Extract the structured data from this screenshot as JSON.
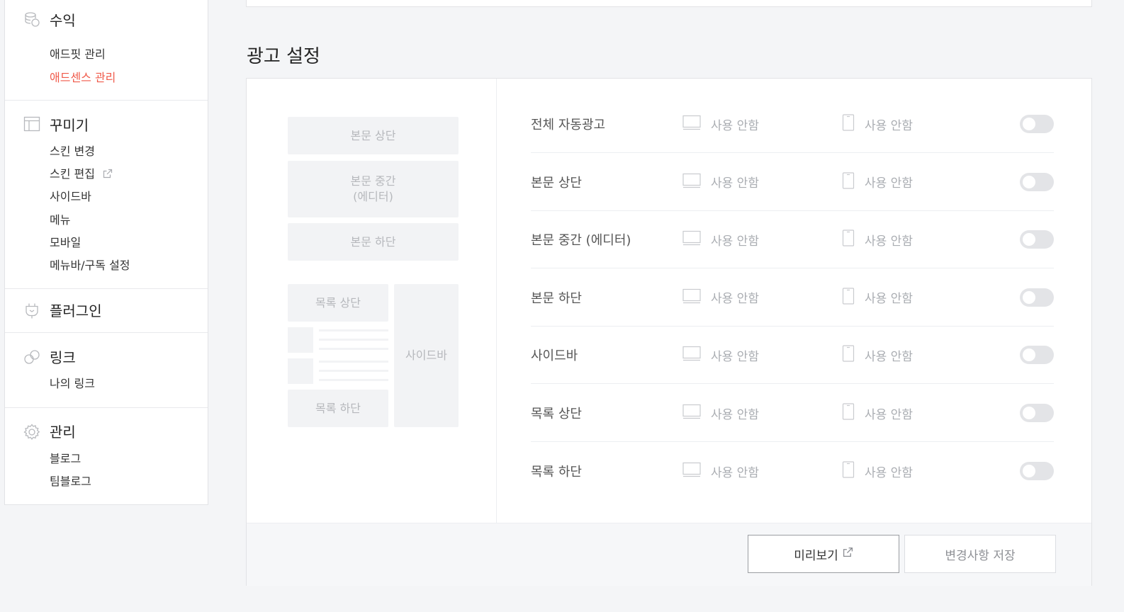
{
  "sidebar": {
    "revenue": {
      "title": "수익",
      "items": [
        "애드핏 관리",
        "애드센스 관리"
      ],
      "active_index": 1
    },
    "decorate": {
      "title": "꾸미기",
      "items": [
        "스킨 변경",
        "스킨 편집",
        "사이드바",
        "메뉴",
        "모바일",
        "메뉴바/구독 설정"
      ]
    },
    "plugin": {
      "title": "플러그인"
    },
    "link": {
      "title": "링크",
      "items": [
        "나의 링크"
      ]
    },
    "manage": {
      "title": "관리",
      "items": [
        "블로그",
        "팀블로그"
      ]
    }
  },
  "main": {
    "title": "광고 설정",
    "preview_blocks": {
      "body_top": "본문 상단",
      "body_mid_line1": "본문 중간",
      "body_mid_line2": "(에디터)",
      "body_bottom": "본문 하단",
      "list_top": "목록 상단",
      "list_bottom": "목록 하단",
      "sidebar": "사이드바"
    },
    "rows": [
      {
        "label": "전체 자동광고",
        "pc": "사용 안함",
        "mobile": "사용 안함",
        "enabled": false
      },
      {
        "label": "본문 상단",
        "pc": "사용 안함",
        "mobile": "사용 안함",
        "enabled": false
      },
      {
        "label": "본문 중간 (에디터)",
        "pc": "사용 안함",
        "mobile": "사용 안함",
        "enabled": false
      },
      {
        "label": "본문 하단",
        "pc": "사용 안함",
        "mobile": "사용 안함",
        "enabled": false
      },
      {
        "label": "사이드바",
        "pc": "사용 안함",
        "mobile": "사용 안함",
        "enabled": false
      },
      {
        "label": "목록 상단",
        "pc": "사용 안함",
        "mobile": "사용 안함",
        "enabled": false
      },
      {
        "label": "목록 하단",
        "pc": "사용 안함",
        "mobile": "사용 안함",
        "enabled": false
      }
    ],
    "buttons": {
      "preview": "미리보기",
      "save": "변경사항 저장"
    }
  },
  "colors": {
    "accent": "#f05a4a",
    "toggle_off": "#e3e4e7"
  },
  "icons": {
    "revenue": "coins-icon",
    "decorate": "layout-icon",
    "plugin": "plug-icon",
    "link": "link-icon",
    "manage": "gear-icon",
    "external": "external-link-icon",
    "pc": "monitor-icon",
    "mobile": "phone-icon"
  }
}
